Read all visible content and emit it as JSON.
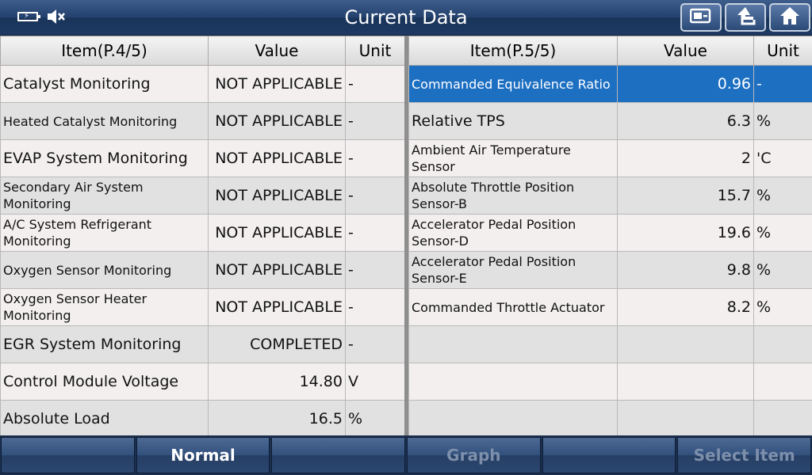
{
  "window": {
    "title": "Current Data"
  },
  "left_table": {
    "headers": {
      "item": "Item(P.4/5)",
      "value": "Value",
      "unit": "Unit"
    },
    "rows": [
      {
        "item": "Catalyst Monitoring",
        "value": "NOT APPLICABLE",
        "unit": "-"
      },
      {
        "item": "Heated Catalyst Monitoring",
        "value": "NOT APPLICABLE",
        "unit": "-"
      },
      {
        "item": "EVAP System Monitoring",
        "value": "NOT APPLICABLE",
        "unit": "-"
      },
      {
        "item": "Secondary Air System Monitoring",
        "value": "NOT APPLICABLE",
        "unit": "-"
      },
      {
        "item": "A/C System Refrigerant Monitoring",
        "value": "NOT APPLICABLE",
        "unit": "-"
      },
      {
        "item": "Oxygen Sensor Monitoring",
        "value": "NOT APPLICABLE",
        "unit": "-"
      },
      {
        "item": "Oxygen Sensor Heater Monitoring",
        "value": "NOT APPLICABLE",
        "unit": "-"
      },
      {
        "item": "EGR System Monitoring",
        "value": "COMPLETED",
        "unit": "-"
      },
      {
        "item": "Control Module Voltage",
        "value": "14.80",
        "unit": "V"
      },
      {
        "item": "Absolute Load",
        "value": "16.5",
        "unit": "%"
      }
    ]
  },
  "right_table": {
    "headers": {
      "item": "Item(P.5/5)",
      "value": "Value",
      "unit": "Unit"
    },
    "rows": [
      {
        "item": "Commanded Equivalence Ratio",
        "value": "0.96",
        "unit": "-"
      },
      {
        "item": "Relative TPS",
        "value": "6.3",
        "unit": "%"
      },
      {
        "item": "Ambient Air Temperature Sensor",
        "value": "2",
        "unit": "'C"
      },
      {
        "item": "Absolute Throttle Position Sensor-B",
        "value": "15.7",
        "unit": "%"
      },
      {
        "item": "Accelerator Pedal Position Sensor-D",
        "value": "19.6",
        "unit": "%"
      },
      {
        "item": "Accelerator Pedal Position Sensor-E",
        "value": "9.8",
        "unit": "%"
      },
      {
        "item": "Commanded Throttle Actuator",
        "value": "8.2",
        "unit": "%"
      },
      {
        "item": "",
        "value": "",
        "unit": ""
      },
      {
        "item": "",
        "value": "",
        "unit": ""
      },
      {
        "item": "",
        "value": "",
        "unit": ""
      }
    ]
  },
  "toolbar": {
    "buttons": [
      "",
      "Normal",
      "",
      "Graph",
      "",
      "Select Item"
    ]
  },
  "icons": {
    "status": [
      "battery-charging-icon",
      "speaker-muted-icon"
    ],
    "titlebar": [
      "screenshot-icon",
      "back-icon",
      "home-icon"
    ]
  },
  "colors": {
    "selected_row": "#1d6fc2",
    "titlebar": "#24416d",
    "row_light": "#f3efef",
    "row_dark": "#e2e1e1"
  }
}
